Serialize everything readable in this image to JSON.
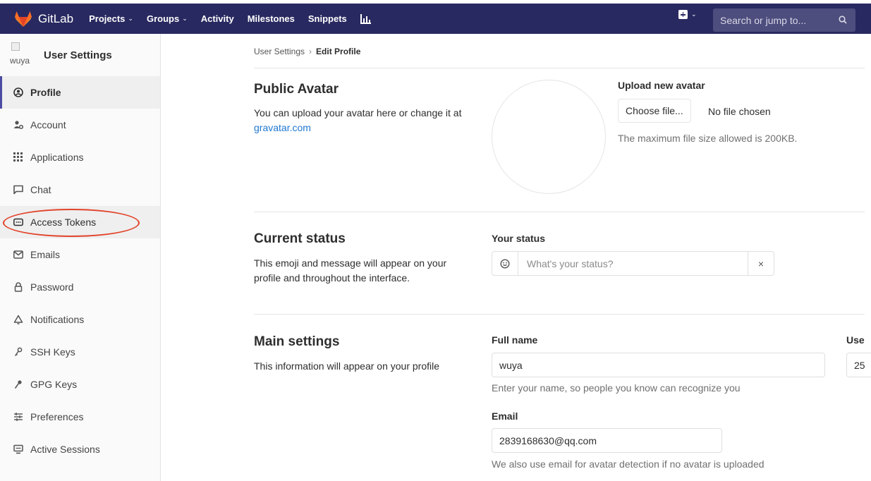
{
  "navbar": {
    "logo_text": "GitLab",
    "items": [
      {
        "label": "Projects",
        "dropdown": true
      },
      {
        "label": "Groups",
        "dropdown": true
      },
      {
        "label": "Activity",
        "dropdown": false
      },
      {
        "label": "Milestones",
        "dropdown": false
      },
      {
        "label": "Snippets",
        "dropdown": false
      }
    ],
    "chart_icon": "chart-icon",
    "plus_icon": "plus-square-icon",
    "search_placeholder": "Search or jump to...",
    "colors": {
      "bg": "#292961",
      "search_bg": "#4d4d7e",
      "logo": "#fc6d26"
    }
  },
  "sidebar": {
    "avatar_alt": "wuya",
    "title": "User Settings",
    "items": [
      {
        "label": "Profile",
        "icon": "profile-icon",
        "active": true
      },
      {
        "label": "Account",
        "icon": "account-icon"
      },
      {
        "label": "Applications",
        "icon": "applications-icon"
      },
      {
        "label": "Chat",
        "icon": "chat-icon"
      },
      {
        "label": "Access Tokens",
        "icon": "token-icon",
        "highlighted": true
      },
      {
        "label": "Emails",
        "icon": "email-icon"
      },
      {
        "label": "Password",
        "icon": "lock-icon"
      },
      {
        "label": "Notifications",
        "icon": "bell-icon"
      },
      {
        "label": "SSH Keys",
        "icon": "key-icon"
      },
      {
        "label": "GPG Keys",
        "icon": "key-icon"
      },
      {
        "label": "Preferences",
        "icon": "preferences-icon"
      },
      {
        "label": "Active Sessions",
        "icon": "monitor-icon"
      }
    ]
  },
  "breadcrumb": {
    "parent": "User Settings",
    "current": "Edit Profile"
  },
  "avatar_section": {
    "title": "Public Avatar",
    "desc_prefix": "You can upload your avatar here or change it at ",
    "link": "gravatar.com",
    "upload_label": "Upload new avatar",
    "choose_button": "Choose file...",
    "no_file": "No file chosen",
    "max_size_help": "The maximum file size allowed is 200KB."
  },
  "status_section": {
    "title": "Current status",
    "desc": "This emoji and message will appear on your profile and throughout the interface.",
    "label": "Your status",
    "placeholder": "What's your status?",
    "clear": "×"
  },
  "main_settings": {
    "title": "Main settings",
    "desc": "This information will appear on your profile",
    "full_name_label": "Full name",
    "full_name_value": "wuya",
    "full_name_help": "Enter your name, so people you know can recognize you",
    "user_id_label_partial": "Use",
    "user_id_value_partial": "25",
    "email_label": "Email",
    "email_value": "2839168630@qq.com",
    "email_help": "We also use email for avatar detection if no avatar is uploaded"
  }
}
